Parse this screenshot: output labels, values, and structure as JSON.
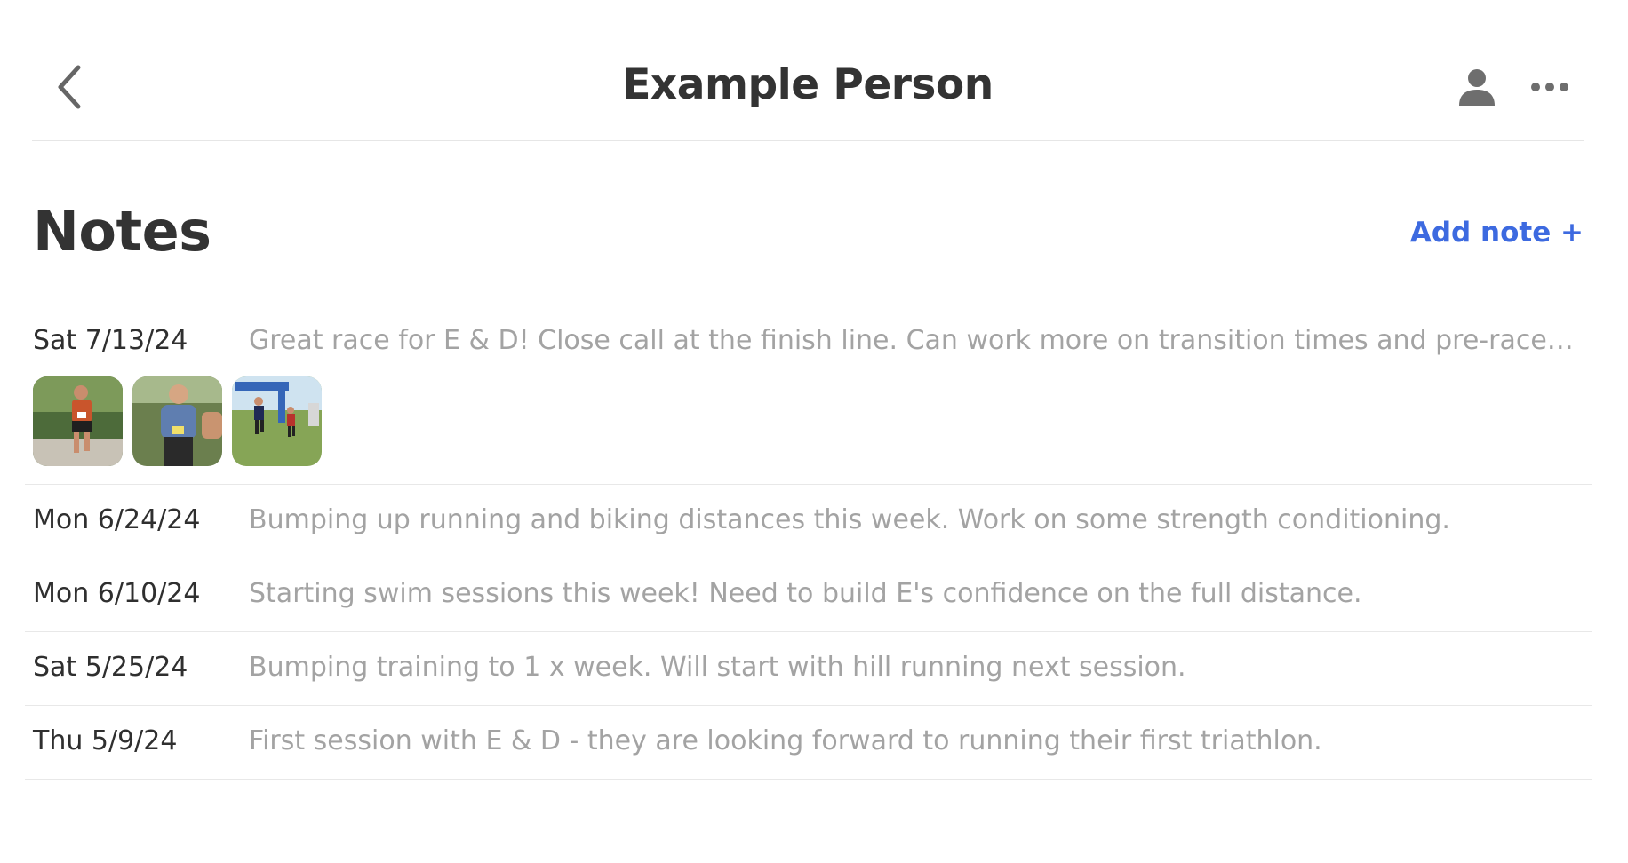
{
  "header": {
    "title": "Example Person",
    "back_icon": "chevron-left-icon",
    "person_icon": "person-icon",
    "more_icon": "ellipsis-icon"
  },
  "notes": {
    "title": "Notes",
    "add_label": "Add note +",
    "accent_color": "#3d6ae0",
    "items": [
      {
        "date": "Sat 7/13/24",
        "text": "Great race for E & D! Close call at the finish line. Can work more on transition times and pre-race pr...",
        "photos": [
          "race-photo-1",
          "race-photo-2",
          "race-photo-3"
        ]
      },
      {
        "date": "Mon 6/24/24",
        "text": "Bumping up running and biking distances this week. Work on some strength conditioning."
      },
      {
        "date": "Mon 6/10/24",
        "text": "Starting swim sessions this week! Need to build E's confidence on the full distance."
      },
      {
        "date": "Sat 5/25/24",
        "text": "Bumping training to 1 x week. Will start with hill running next session."
      },
      {
        "date": "Thu 5/9/24",
        "text": "First session with E & D - they are looking forward to running their first triathlon."
      }
    ]
  }
}
